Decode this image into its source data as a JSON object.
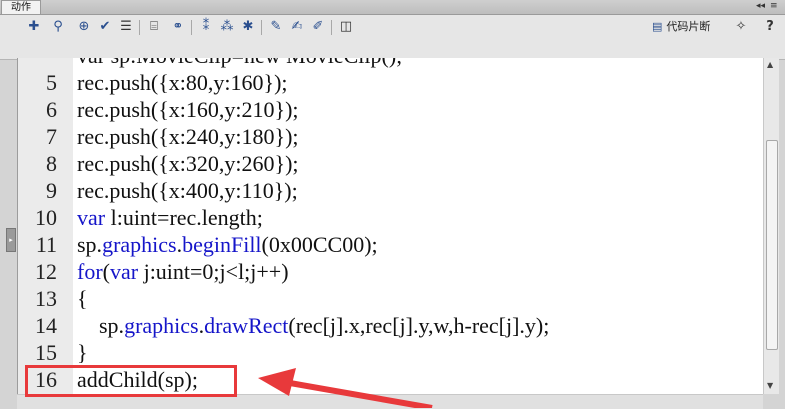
{
  "panel": {
    "tab_label": "动作"
  },
  "toolbar": {
    "code_snippets_label": "代码片断",
    "help_label": "?"
  },
  "editor": {
    "partial_top_line": "var sp:MovieClip=new MovieClip();",
    "lines": [
      {
        "num": "5",
        "code": "rec.push({x:80,y:160});"
      },
      {
        "num": "6",
        "code": "rec.push({x:160,y:210});"
      },
      {
        "num": "7",
        "code": "rec.push({x:240,y:180});"
      },
      {
        "num": "8",
        "code": "rec.push({x:320,y:260});"
      },
      {
        "num": "9",
        "code": "rec.push({x:400,y:110});"
      },
      {
        "num": "10",
        "code_kw": "var",
        "code_rest": " l:uint=rec.length;"
      },
      {
        "num": "11",
        "code_pre": "sp.",
        "code_fn": "graphics",
        "code_mid": ".",
        "code_fn2": "beginFill",
        "code_rest": "(0x00CC00);"
      },
      {
        "num": "12",
        "code_kw": "for",
        "code_mid": "(",
        "code_kw2": "var",
        "code_rest": " j:uint=0;j<l;j++)"
      },
      {
        "num": "13",
        "code": "{"
      },
      {
        "num": "14",
        "code_pre": "    sp.",
        "code_fn": "graphics",
        "code_mid": ".",
        "code_fn2": "drawRect",
        "code_rest": "(rec[j].x,rec[j].y,w,h-rec[j].y);"
      },
      {
        "num": "15",
        "code": "}"
      },
      {
        "num": "16",
        "code": "addChild(sp);"
      }
    ]
  },
  "colors": {
    "keyword": "#1515c9",
    "highlight_box": "#e8393b",
    "arrow": "#e8393b"
  }
}
